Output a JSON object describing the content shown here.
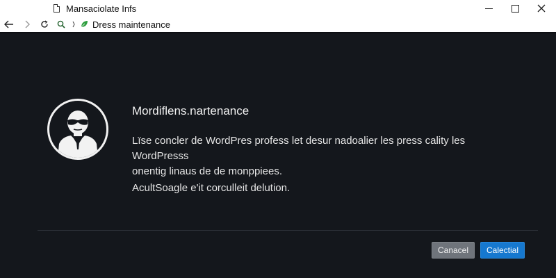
{
  "window": {
    "title": "Mansaciolate Infs",
    "address": "Dress maintenance"
  },
  "dialog": {
    "title": "Mordiflens.nartenance",
    "body_line1": "Lïse concler de WordPres profess let desur nadoalier les press cality les WordPresss",
    "body_line2": "onentig linaus de de monppiees.",
    "secondary": "AcultSoagle e'it corculleit delution.",
    "cancel_label": "Canacel",
    "confirm_label": "Calectial"
  },
  "icons": {
    "document": "document-icon",
    "back": "back-arrow-icon",
    "forward": "forward-arrow-icon",
    "reload": "reload-icon",
    "search": "search-icon",
    "separator": "separator-icon",
    "leaf": "leaf-icon",
    "avatar": "avatar-icon",
    "minimize": "minimize-icon",
    "maximize": "maximize-icon",
    "close": "close-icon"
  },
  "colors": {
    "content_background": "#14171c",
    "confirm_button": "#1678cf",
    "cancel_button": "#6f747b",
    "leaf_green": "#2e9e3e"
  }
}
